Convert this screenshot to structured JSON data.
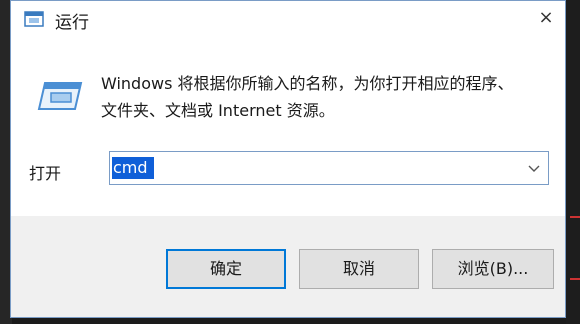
{
  "window": {
    "title": "运行",
    "close_glyph": "×"
  },
  "description": [
    "Windows 将根据你所输入的名称，为你打开相应的程序、",
    "文件夹、文档或 Internet 资源。"
  ],
  "open_label": "打开",
  "command": {
    "value": "cmd"
  },
  "buttons": {
    "ok": "确定",
    "cancel": "取消",
    "browse": "浏览(B)..."
  },
  "colors": {
    "accent": "#0078d7",
    "selection": "#0f5fd8",
    "footer": "#f0f0f0"
  },
  "icons": {
    "title": "run-app-icon",
    "content": "run-app-icon",
    "dropdown": "chevron-down-icon",
    "close": "close-icon"
  }
}
